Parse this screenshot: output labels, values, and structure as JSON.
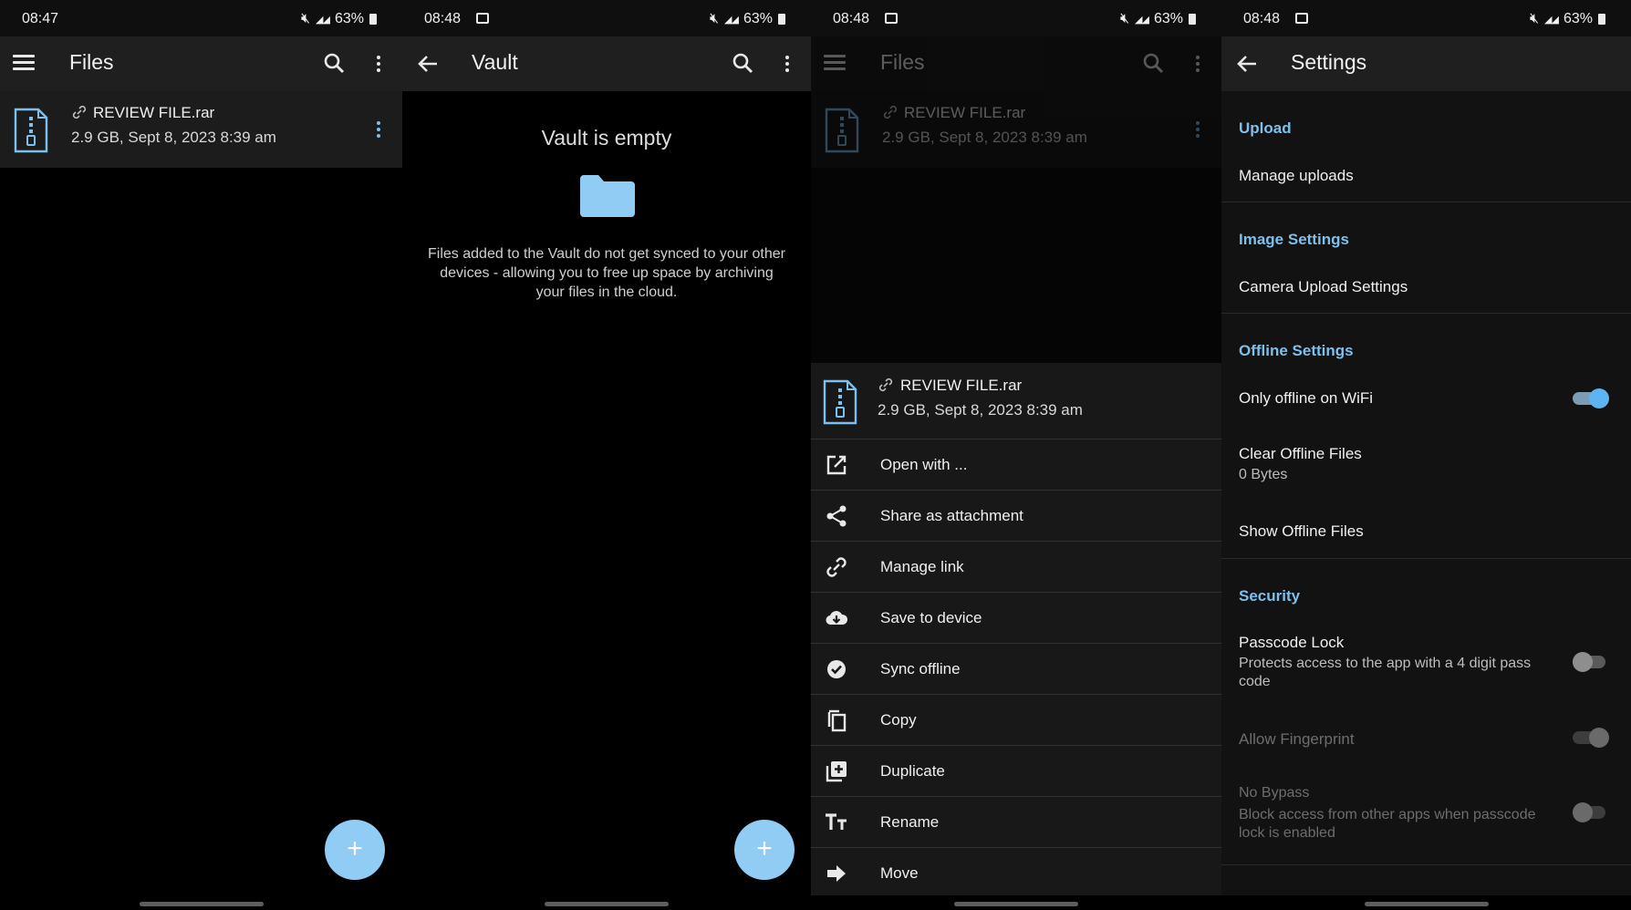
{
  "panels": [
    {
      "status": {
        "time": "08:47",
        "battery": "63%"
      },
      "appbar": {
        "title": "Files"
      },
      "file": {
        "name": "REVIEW FILE.rar",
        "meta": "2.9 GB, Sept 8, 2023 8:39 am"
      },
      "fab": "+"
    },
    {
      "status": {
        "time": "08:48",
        "battery": "63%"
      },
      "appbar": {
        "title": "Vault"
      },
      "empty_title": "Vault is empty",
      "empty_desc": "Files added to the Vault do not get synced to your other devices - allowing you to free up space by archiving your files in the cloud.",
      "fab": "+"
    },
    {
      "status": {
        "time": "08:48",
        "battery": "63%"
      },
      "appbar": {
        "title": "Files"
      },
      "file": {
        "name": "REVIEW FILE.rar",
        "meta": "2.9 GB, Sept 8, 2023 8:39 am"
      },
      "sheet": {
        "file": {
          "name": "REVIEW FILE.rar",
          "meta": "2.9 GB, Sept 8, 2023 8:39 am"
        },
        "items": [
          {
            "label": "Open with ...",
            "icon": "open-external-icon"
          },
          {
            "label": "Share as attachment",
            "icon": "share-icon"
          },
          {
            "label": "Manage link",
            "icon": "link-icon"
          },
          {
            "label": "Save to device",
            "icon": "cloud-download-icon"
          },
          {
            "label": "Sync offline",
            "icon": "check-circle-icon"
          },
          {
            "label": "Copy",
            "icon": "copy-icon"
          },
          {
            "label": "Duplicate",
            "icon": "duplicate-icon"
          },
          {
            "label": "Rename",
            "icon": "rename-icon"
          },
          {
            "label": "Move",
            "icon": "move-arrow-icon"
          }
        ]
      }
    },
    {
      "status": {
        "time": "08:48",
        "battery": "63%"
      },
      "appbar": {
        "title": "Settings"
      },
      "sections": {
        "upload": {
          "header": "Upload",
          "manage_uploads": "Manage uploads"
        },
        "image": {
          "header": "Image Settings",
          "camera_upload": "Camera Upload Settings"
        },
        "offline": {
          "header": "Offline Settings",
          "only_wifi": "Only offline on WiFi",
          "only_wifi_on": true,
          "clear": "Clear Offline Files",
          "clear_size": "0 Bytes",
          "show": "Show Offline Files"
        },
        "security": {
          "header": "Security",
          "passcode": "Passcode Lock",
          "passcode_desc": "Protects access to the app with a 4 digit pass code",
          "passcode_on": false,
          "fingerprint": "Allow Fingerprint",
          "no_bypass": "No Bypass",
          "no_bypass_desc": "Block access from other apps when passcode lock is enabled"
        }
      }
    }
  ],
  "colors": {
    "accent": "#90ccf4",
    "header": "#7cc0ee",
    "background": "#000000"
  }
}
